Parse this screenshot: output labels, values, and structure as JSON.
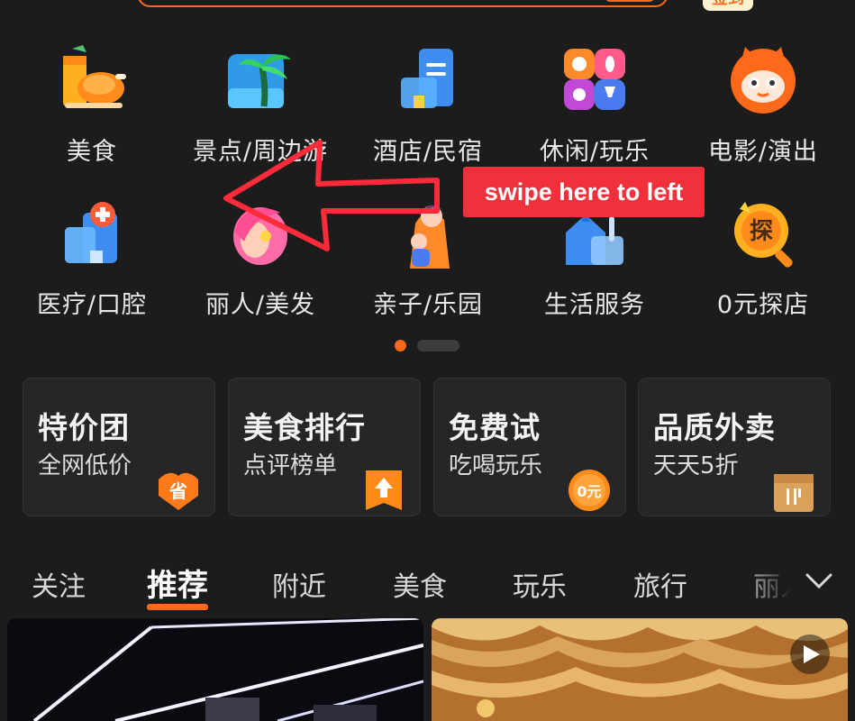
{
  "header": {
    "sign_label": "签到"
  },
  "categories": [
    {
      "label": "美食",
      "icon": "roast-chicken-drink-icon"
    },
    {
      "label": "景点/周边游",
      "icon": "palm-tree-icon"
    },
    {
      "label": "酒店/民宿",
      "icon": "hotel-building-icon"
    },
    {
      "label": "休闲/玩乐",
      "icon": "leisure-grid-icon"
    },
    {
      "label": "电影/演出",
      "icon": "cat-face-icon"
    },
    {
      "label": "医疗/口腔",
      "icon": "medical-building-icon"
    },
    {
      "label": "丽人/美发",
      "icon": "beauty-hair-icon"
    },
    {
      "label": "亲子/乐园",
      "icon": "parent-child-icon"
    },
    {
      "label": "生活服务",
      "icon": "home-service-icon"
    },
    {
      "label": "0元探店",
      "icon": "explore-magnifier-icon"
    }
  ],
  "pager": {
    "active_index": 0,
    "pages": 2
  },
  "promo_cards": [
    {
      "title": "特价团",
      "subtitle": "全网低价",
      "badge": "省",
      "icon": "save-badge-icon"
    },
    {
      "title": "美食排行",
      "subtitle": "点评榜单",
      "badge": "",
      "icon": "rank-up-arrow-icon"
    },
    {
      "title": "免费试",
      "subtitle": "吃喝玩乐",
      "badge": "0元",
      "icon": "zero-yuan-coin-icon"
    },
    {
      "title": "品质外卖",
      "subtitle": "天天5折",
      "badge": "",
      "icon": "takeout-bag-icon"
    }
  ],
  "tabs": [
    "关注",
    "推荐",
    "附近",
    "美食",
    "玩乐",
    "旅行",
    "丽人"
  ],
  "active_tab": "推荐",
  "annotation": {
    "text": "swipe here to left"
  },
  "colors": {
    "accent": "#ff6a1a",
    "background": "#1c1c1c",
    "callout": "#f0313c"
  }
}
